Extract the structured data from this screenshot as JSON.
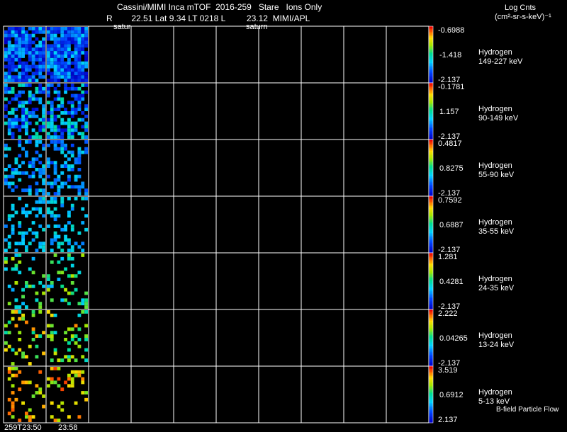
{
  "header": {
    "title": "Cassini/MIMI Inca mTOF  2016-259   Stare   Ions Only",
    "line2": "R        22.51 Lat 9.34 LT 0218 L         23.12  MIMI/APL",
    "marker_left": "satur",
    "marker_center": "saturn",
    "units_line1": "Log Cnts",
    "units_line2": "(cm²-sr-s-keV)⁻¹"
  },
  "footer": {
    "time_left": "259T23:50",
    "time_right": "23:58",
    "bfield_label": "B-field Particle Flow"
  },
  "colors": {
    "frame": "#ffffff",
    "background": "#000000"
  },
  "chart_data": {
    "type": "heatmap",
    "colorscale": "rainbow (blue → cyan → green → yellow → red)",
    "columns_total": 10,
    "columns_with_data": 2,
    "x_tick_labels": [
      "259T23:50",
      "23:58"
    ],
    "panels": [
      {
        "species": "Hydrogen",
        "energy": "149-227 keV",
        "cbar_max": "-0.6988",
        "cbar_mid": "-1.418",
        "cbar_min": "-2.137",
        "fill_fraction": 0.85,
        "level_range": [
          0.0,
          0.38
        ],
        "seed": 11
      },
      {
        "species": "Hydrogen",
        "energy": "90-149 keV",
        "cbar_max": "-0.1781",
        "cbar_mid": "1.157",
        "cbar_min": "-2.137",
        "fill_fraction": 0.55,
        "level_range": [
          0.02,
          0.5
        ],
        "seed": 23
      },
      {
        "species": "Hydrogen",
        "energy": "55-90 keV",
        "cbar_max": "0.4817",
        "cbar_mid": "0.8275",
        "cbar_min": "-2.137",
        "fill_fraction": 0.4,
        "level_range": [
          0.15,
          0.42
        ],
        "seed": 37
      },
      {
        "species": "Hydrogen",
        "energy": "35-55 keV",
        "cbar_max": "0.7592",
        "cbar_mid": "0.6887",
        "cbar_min": "-2.137",
        "fill_fraction": 0.3,
        "level_range": [
          0.25,
          0.45
        ],
        "seed": 41
      },
      {
        "species": "Hydrogen",
        "energy": "24-35 keV",
        "cbar_max": "1.281",
        "cbar_mid": "0.4281",
        "cbar_min": "-2.137",
        "fill_fraction": 0.2,
        "level_range": [
          0.3,
          0.72
        ],
        "seed": 53
      },
      {
        "species": "Hydrogen",
        "energy": "13-24 keV",
        "cbar_max": "2.222",
        "cbar_mid": "0.04265",
        "cbar_min": "-2.137",
        "fill_fraction": 0.22,
        "level_range": [
          0.38,
          0.88
        ],
        "seed": 67
      },
      {
        "species": "Hydrogen",
        "energy": "5-13 keV",
        "cbar_max": "3.519",
        "cbar_mid": "0.6912",
        "cbar_min": "2.137",
        "fill_fraction": 0.18,
        "level_range": [
          0.6,
          0.95
        ],
        "seed": 79
      }
    ]
  }
}
